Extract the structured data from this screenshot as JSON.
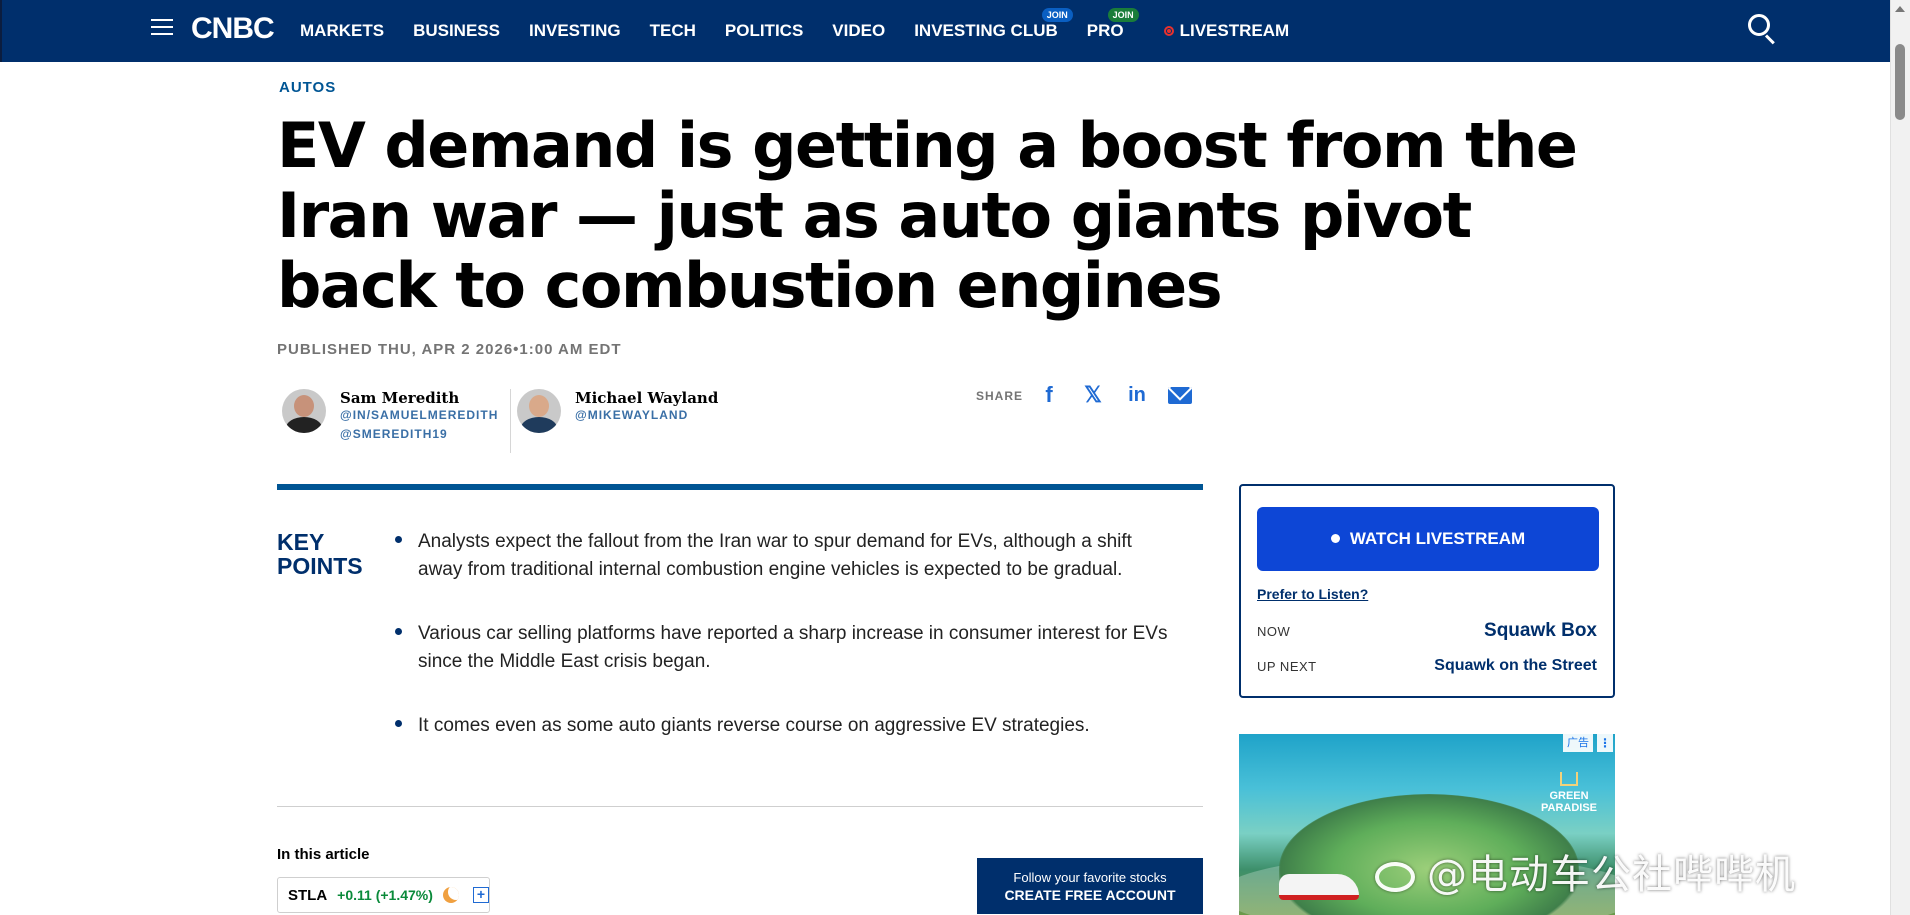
{
  "nav": {
    "logo": "CNBC",
    "items": [
      {
        "label": "MARKETS"
      },
      {
        "label": "BUSINESS"
      },
      {
        "label": "INVESTING"
      },
      {
        "label": "TECH"
      },
      {
        "label": "POLITICS"
      },
      {
        "label": "VIDEO"
      },
      {
        "label": "INVESTING CLUB",
        "badge": "JOIN",
        "badge_color": "#0a5fc2"
      },
      {
        "label": "PRO",
        "badge": "JOIN",
        "badge_color": "#1a7d3a"
      },
      {
        "label": "LIVESTREAM",
        "live": true
      }
    ],
    "icons": [
      "hamburger-menu-icon",
      "search-icon"
    ],
    "background": "#002f6c"
  },
  "article": {
    "section": "AUTOS",
    "headline": "EV demand is getting a boost from the Iran war — just as auto giants pivot back to combustion engines",
    "published": "PUBLISHED THU, APR 2 2026•1:00 AM EDT",
    "authors": [
      {
        "name": "Sam Meredith",
        "handles": [
          "@IN/SAMUELMEREDITH",
          "@SMEREDITH19"
        ]
      },
      {
        "name": "Michael Wayland",
        "handles": [
          "@MIKEWAYLAND"
        ]
      }
    ],
    "share_label": "SHARE",
    "share_icons": [
      "facebook-icon",
      "x-icon",
      "linkedin-icon",
      "email-icon"
    ],
    "key_points_title": "KEY POINTS",
    "key_points": [
      "Analysts expect the fallout from the Iran war to spur demand for EVs, although a shift away from traditional internal combustion engine vehicles is expected to be gradual.",
      "Various car selling platforms have reported a sharp increase in consumer interest for EVs since the Middle East crisis began.",
      "It comes even as some auto giants reverse course on aggressive EV strategies."
    ],
    "in_this_article": "In this article",
    "ticker": {
      "symbol": "STLA",
      "change": "+0.11 (+1.47%)"
    },
    "follow": {
      "line1": "Follow your favorite stocks",
      "line2": "CREATE FREE ACCOUNT"
    }
  },
  "livestream": {
    "watch_label": "WATCH LIVESTREAM",
    "prefer_link": "Prefer to Listen?",
    "now_label": "NOW",
    "now_show": "Squawk Box",
    "next_label": "UP NEXT",
    "next_show": "Squawk on the Street"
  },
  "ad": {
    "tag": "广告",
    "menu": "⋮",
    "brand_line1": "GREEN",
    "brand_line2": "PARADISE"
  },
  "watermark": "@电动车公社哔哔机",
  "colors": {
    "brand_navy": "#002f6c",
    "link_blue": "#005594",
    "watch_button": "#0d46d6",
    "positive": "#0a8a3a"
  }
}
